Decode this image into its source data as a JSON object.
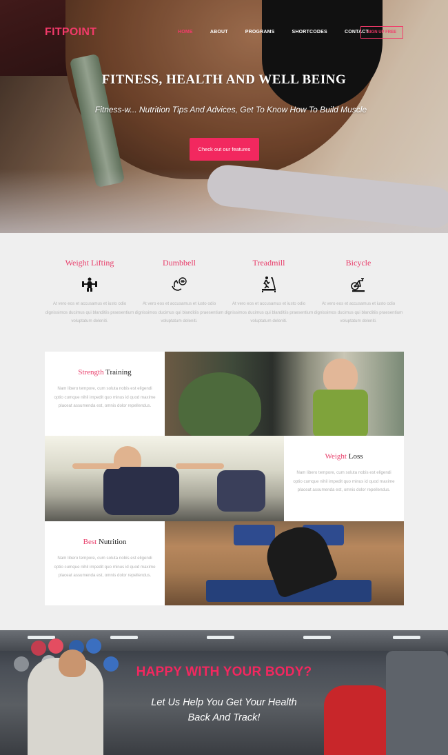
{
  "brand": {
    "logo": "FITPOINT",
    "accent": "#f23a6a"
  },
  "nav": {
    "items": [
      {
        "label": "HOME",
        "active": true
      },
      {
        "label": "ABOUT",
        "active": false
      },
      {
        "label": "PROGRAMS",
        "active": false
      },
      {
        "label": "SHORTCODES",
        "active": false
      },
      {
        "label": "CONTACT",
        "active": false
      }
    ],
    "signup_label": "SIGN UP FREE"
  },
  "hero": {
    "title": "FITNESS, HEALTH AND WELL BEING",
    "subtitle": "Fitness-w... Nutrition Tips And Advices, Get To Know How To Build Muscle",
    "cta_label": "Check out our features"
  },
  "features": [
    {
      "title": "Weight Lifting",
      "icon": "weightlifting-icon",
      "text": "At vero eos et accusamus et iusto odio dignissimos ducimus qui blanditiis praesentium voluptatum deleniti."
    },
    {
      "title": "Dumbbell",
      "icon": "dumbbell-icon",
      "text": "At vero eos et accusamus et iusto odio dignissimos ducimus qui blanditiis praesentium voluptatum deleniti."
    },
    {
      "title": "Treadmill",
      "icon": "treadmill-icon",
      "text": "At vero eos et accusamus et iusto odio dignissimos ducimus qui blanditiis praesentium voluptatum deleniti."
    },
    {
      "title": "Bicycle",
      "icon": "bicycle-icon",
      "text": "At vero eos et accusamus et iusto odio dignissimos ducimus qui blanditiis praesentium voluptatum deleniti."
    }
  ],
  "programs": [
    {
      "highlight": "Strength",
      "rest": " Training",
      "text": "Nam libero tempore, cum soluta nobis est eligendi optio cumque nihil impedit quo minus id quod maxime placeat assumenda est, omnis dolor repellendus."
    },
    {
      "highlight": "Weight",
      "rest": " Loss",
      "text": "Nam libero tempore, cum soluta nobis est eligendi optio cumque nihil impedit quo minus id quod maxime placeat assumenda est, omnis dolor repellendus."
    },
    {
      "highlight": "Best",
      "rest": " Nutrition",
      "text": "Nam libero tempore, cum soluta nobis est eligendi optio cumque nihil impedit quo minus id quod maxime placeat assumenda est, omnis dolor repellendus."
    }
  ],
  "banner": {
    "title": "HAPPY WITH YOUR BODY?",
    "line1": "Let Us Help You Get Your Health",
    "line2": "Back And Track!"
  }
}
